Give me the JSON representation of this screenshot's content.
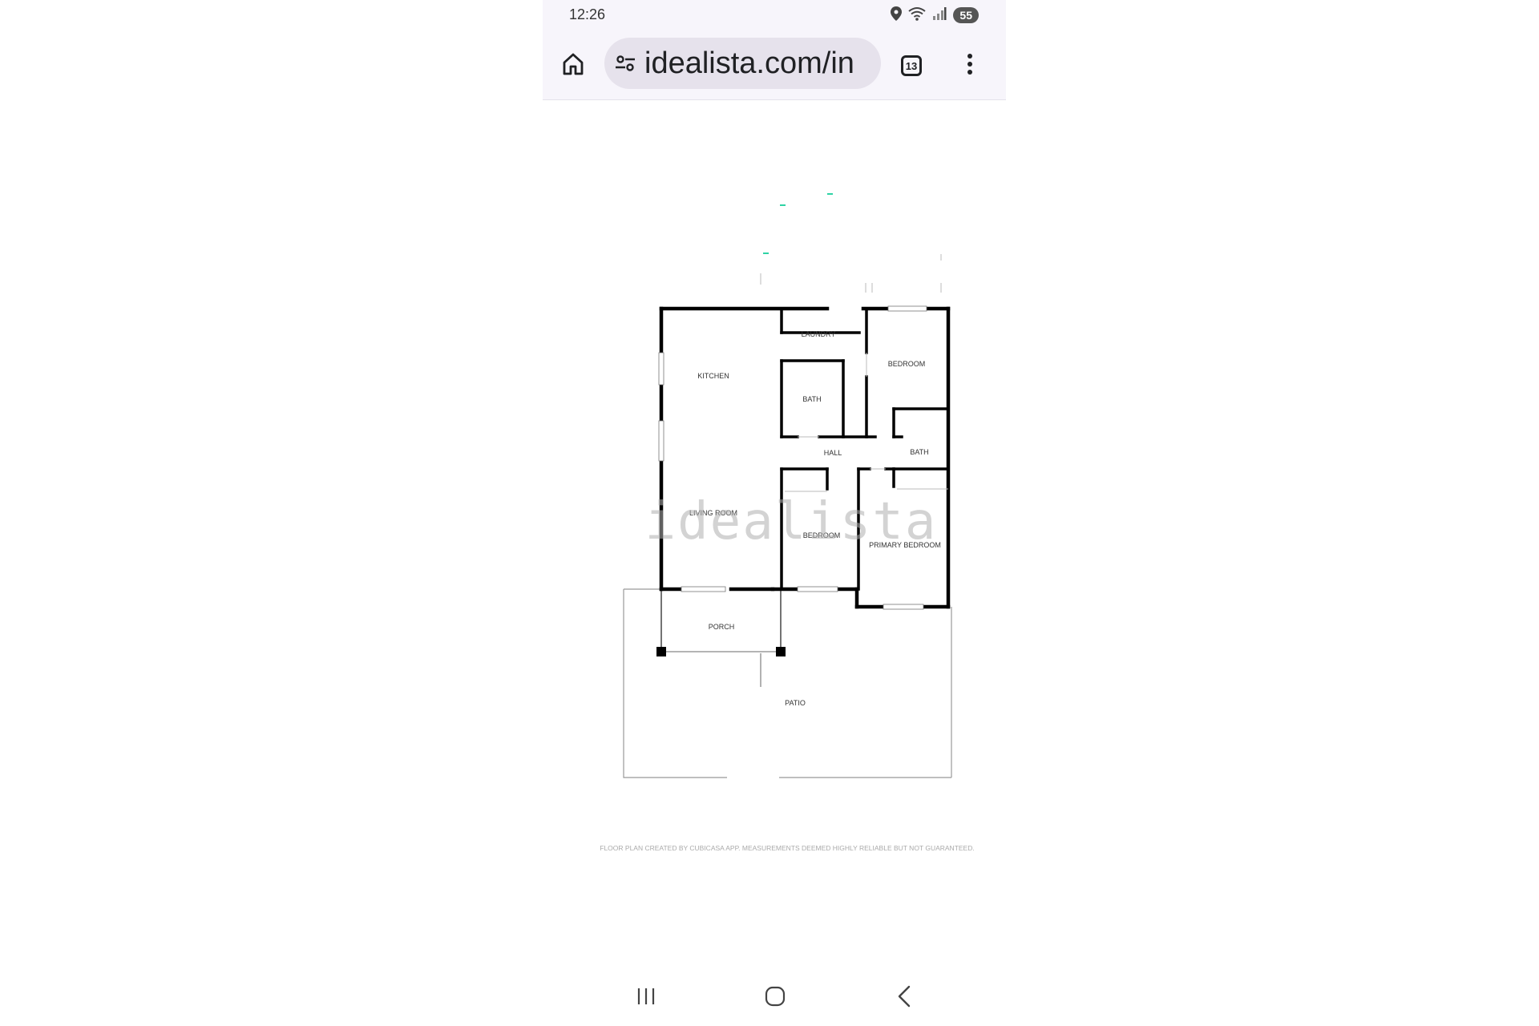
{
  "status_bar": {
    "time": "12:26",
    "battery": "55"
  },
  "browser": {
    "url": "idealista.com/in",
    "tab_count": "13"
  },
  "floor_plan": {
    "rooms": {
      "laundry": "LAUNDRY",
      "kitchen": "KITCHEN",
      "bedroom_top": "BEDROOM",
      "bath_left": "BATH",
      "hall": "HALL",
      "bath_right": "BATH",
      "living_room": "LIVING ROOM",
      "bedroom_middle": "BEDROOM",
      "primary_bedroom": "PRIMARY BEDROOM",
      "porch": "PORCH",
      "patio": "PATIO"
    },
    "watermark": "idealista",
    "disclaimer": "FLOOR PLAN CREATED BY CUBICASA APP. MEASUREMENTS DEEMED HIGHLY RELIABLE BUT NOT GUARANTEED."
  },
  "icons": {
    "home": "home-icon",
    "site_settings": "tune-icon",
    "tabs": "tabs-icon",
    "menu": "more-vert-icon",
    "location": "location-icon",
    "wifi": "wifi-icon",
    "signal": "signal-icon",
    "recents": "recents-icon",
    "home_nav": "home-nav-icon",
    "back": "back-icon"
  },
  "colors": {
    "toolbar_bg": "#f7f5fb",
    "url_pill_bg": "#e6e2ec",
    "wall": "#000000",
    "accent_dots": "#2ed3a5"
  }
}
